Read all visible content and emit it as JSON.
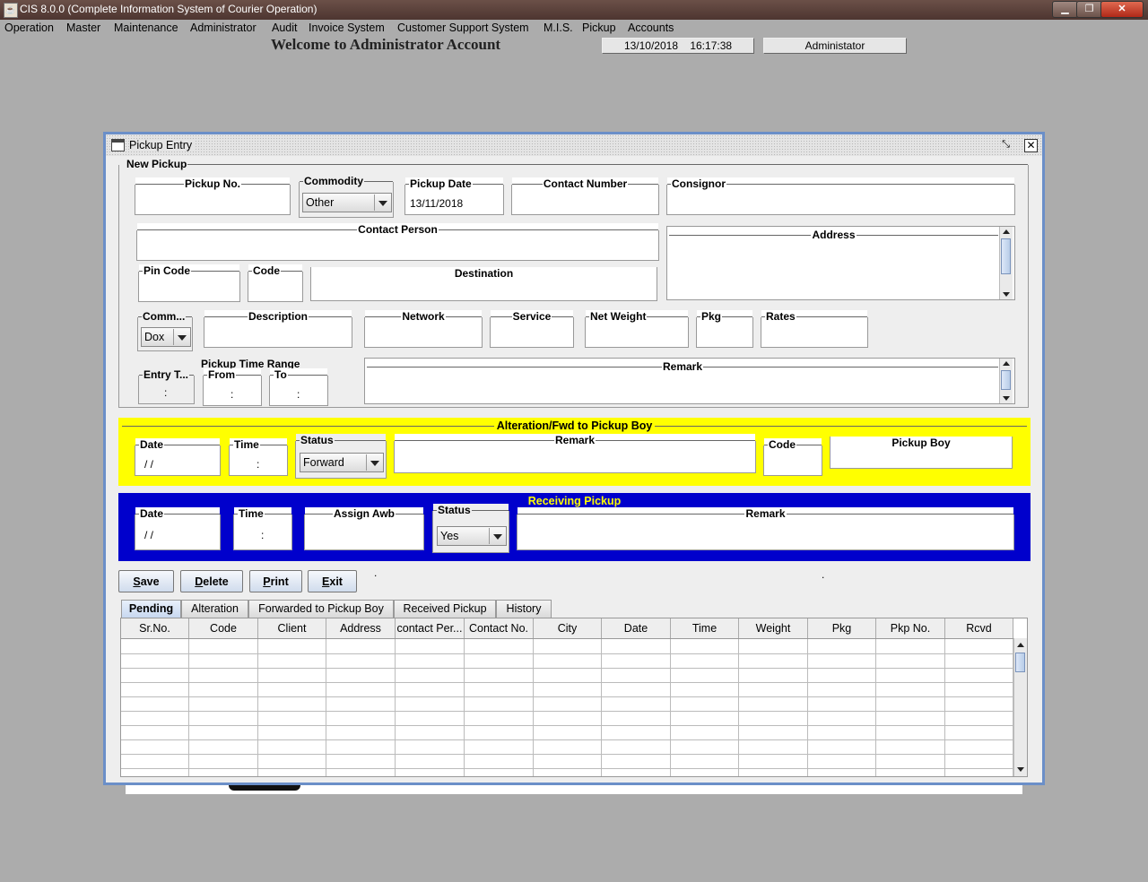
{
  "window": {
    "title": "CIS 8.0.0 (Complete Information System of Courier Operation)",
    "minimize": "▁",
    "maximize": "❐",
    "close": "✕"
  },
  "menubar": [
    "Operation",
    "Master",
    "Maintenance",
    "Administrator",
    "Audit",
    "Invoice System",
    "Customer Support System",
    "M.I.S.",
    "Pickup",
    "Accounts"
  ],
  "header": {
    "welcome": "Welcome to Administrator Account",
    "datetime": "13/10/2018    16:17:38",
    "user": "Administator"
  },
  "frame": {
    "title": "Pickup Entry",
    "new_pickup": {
      "legend": "New Pickup",
      "pickup_no_label": "Pickup No.",
      "commodity_label": "Commodity",
      "commodity_value": "Other",
      "pickup_date_label": "Pickup Date",
      "pickup_date_value": "13/11/2018",
      "contact_number_label": "Contact Number",
      "consignor_label": "Consignor",
      "contact_person_label": "Contact Person",
      "address_label": "Address",
      "pin_code_label": "Pin Code",
      "code_label": "Code",
      "destination_label": "Destination",
      "comm_label": "Comm...",
      "comm_value": "Dox",
      "description_label": "Description",
      "network_label": "Network",
      "service_label": "Service",
      "net_weight_label": "Net Weight",
      "pkg_label": "Pkg",
      "rates_label": "Rates",
      "pickup_time_range": "Pickup Time Range",
      "entry_time_label": "Entry T...",
      "entry_time_value": ":",
      "from_label": "From",
      "from_value": ":",
      "to_label": "To",
      "to_value": ":",
      "remark_label": "Remark"
    },
    "alteration": {
      "title": "Alteration/Fwd to Pickup Boy",
      "date_label": "Date",
      "date_value": "/ /",
      "time_label": "Time",
      "time_value": ":",
      "status_label": "Status",
      "status_value": "Forward",
      "remark_label": "Remark",
      "code_label": "Code",
      "pickup_boy_label": "Pickup Boy"
    },
    "receiving": {
      "title": "Receiving Pickup",
      "date_label": "Date",
      "date_value": "/ /",
      "time_label": "Time",
      "time_value": ":",
      "assign_awb_label": "Assign Awb",
      "status_label": "Status",
      "status_value": "Yes",
      "remark_label": "Remark"
    },
    "buttons": {
      "save": "Save",
      "delete": "Delete",
      "print": "Print",
      "exit": "Exit"
    },
    "dot1": ".",
    "dot2": ".",
    "tabs": [
      "Pending",
      "Alteration",
      "Forwarded to Pickup Boy",
      "Received Pickup",
      "History"
    ],
    "table": {
      "columns": [
        "Sr.No.",
        "Code",
        "Client",
        "Address",
        "contact Per...",
        "Contact No.",
        "City",
        "Date",
        "Time",
        "Weight",
        "Pkg",
        "Pkp No.",
        "Rcvd"
      ],
      "rows": []
    }
  }
}
